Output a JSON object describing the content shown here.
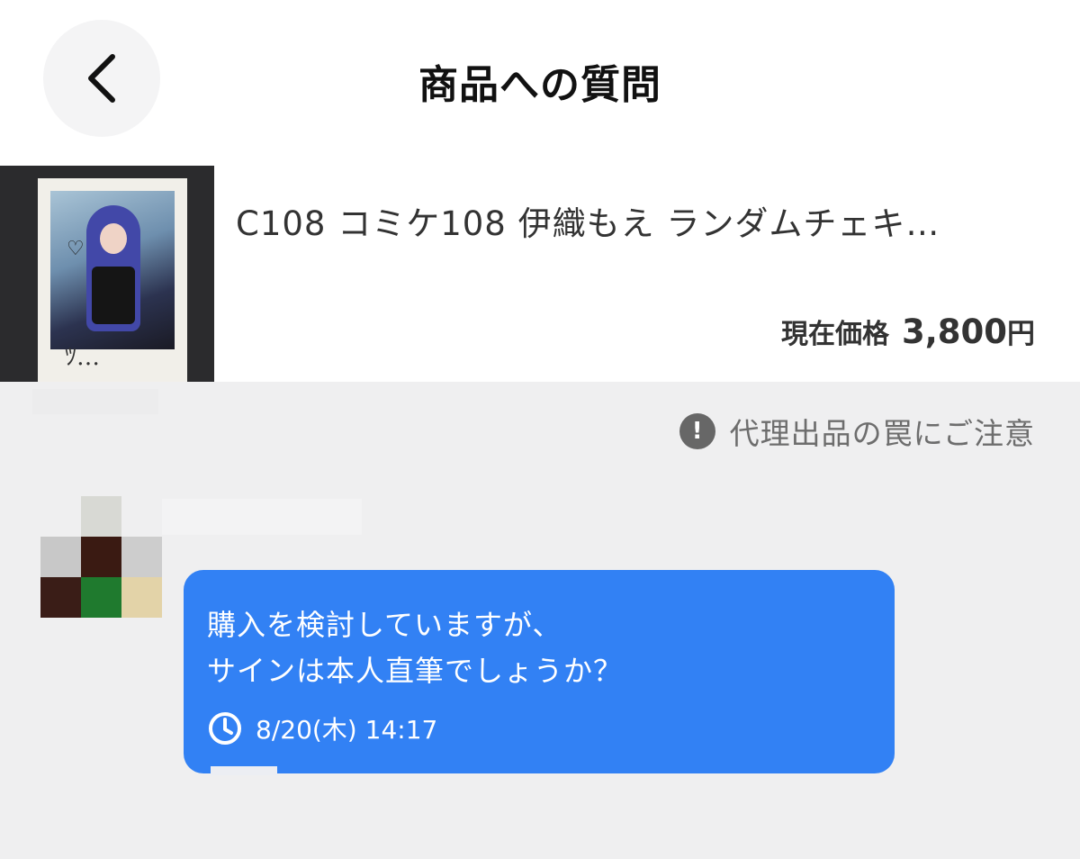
{
  "header": {
    "title": "商品への質問"
  },
  "product": {
    "title": "C108 コミケ108 伊織もえ ランダムチェキ…",
    "price_label": "現在価格",
    "price_value": "3,800",
    "price_unit": "円",
    "thumbnail_icon": "product-photo"
  },
  "notice": {
    "icon": "exclamation-icon",
    "text": "代理出品の罠にご注意"
  },
  "message": {
    "lines": [
      "購入を検討していますが、",
      "サインは本人直筆でしょうか？"
    ],
    "time_icon": "clock-icon",
    "timestamp": "8/20(木) 14:17"
  },
  "colors": {
    "bubble": "#3281f4",
    "background": "#efeff0",
    "notice_icon": "#676767"
  },
  "avatar_pixels": [
    "",
    "#d8d9d4",
    "",
    "#c8c8c8",
    "#3a1a12",
    "#cdcdcd",
    "#3a1d17",
    "#1f7a2e",
    "#e3d3a8"
  ]
}
